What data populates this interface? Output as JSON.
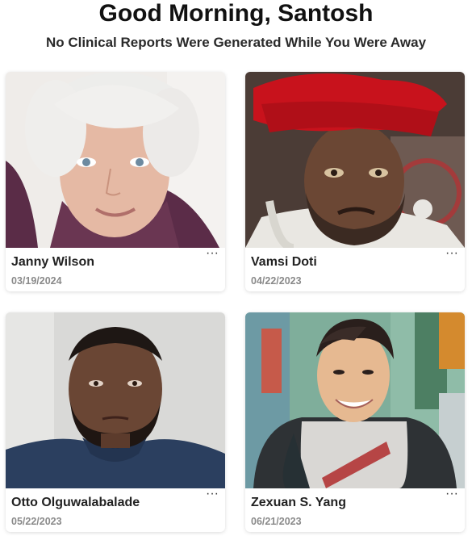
{
  "header": {
    "greeting": "Good Morning, Santosh",
    "subtitle": "No Clinical Reports Were Generated While You Were Away"
  },
  "patients": [
    {
      "name": "Janny Wilson",
      "date": "03/19/2024",
      "menu_icon": "more-horizontal-icon"
    },
    {
      "name": "Vamsi Doti",
      "date": "04/22/2023",
      "menu_icon": "more-horizontal-icon"
    },
    {
      "name": "Otto Olguwalabalade",
      "date": "05/22/2023",
      "menu_icon": "more-horizontal-icon"
    },
    {
      "name": "Zexuan S. Yang",
      "date": "06/21/2023",
      "menu_icon": "more-horizontal-icon"
    }
  ],
  "menu_glyph": "···"
}
